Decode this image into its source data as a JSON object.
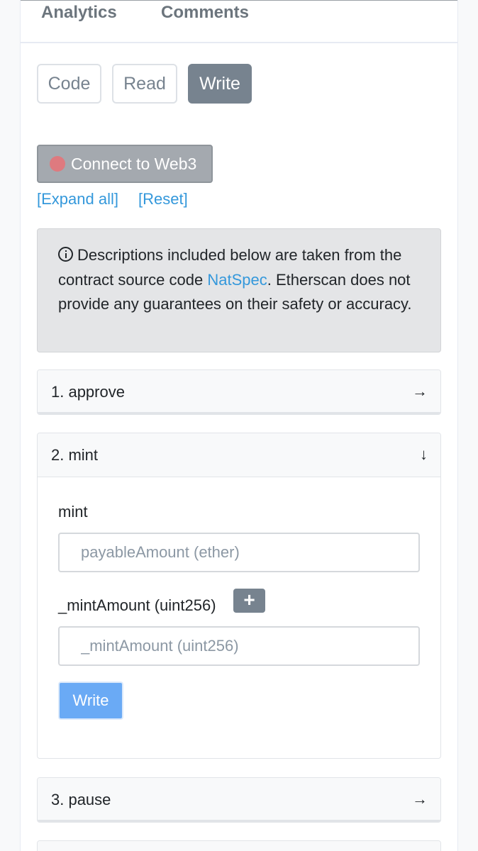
{
  "nav": {
    "tabs": [
      "Analytics",
      "Comments"
    ]
  },
  "subtabs": {
    "code": "Code",
    "read": "Read",
    "write": "Write",
    "active": "write"
  },
  "connect": {
    "label": "Connect to Web3",
    "status_color": "#de7a7f"
  },
  "links": {
    "expand_all": "[Expand all]",
    "reset": "[Reset]"
  },
  "notice": {
    "before": "Descriptions included below are taken from the contract source code ",
    "natspec": "NatSpec",
    "after": ". Etherscan does not provide any guarantees on their safety or accuracy."
  },
  "functions": [
    {
      "title": "1. approve",
      "state": "collapsed",
      "arrow": "→"
    },
    {
      "title": "2. mint",
      "state": "expanded",
      "arrow": "↓"
    },
    {
      "title": "3. pause",
      "state": "collapsed",
      "arrow": "→"
    }
  ],
  "mint_form": {
    "payable_label": "mint",
    "payable_placeholder": "payableAmount (ether)",
    "amount_label": "_mintAmount (uint256)",
    "plus": "+",
    "amount_placeholder": "_mintAmount (uint256)",
    "submit": "Write"
  },
  "colors": {
    "accent": "#3498db",
    "primary_button": "#6aaaf5",
    "active_tab": "#77838f"
  }
}
